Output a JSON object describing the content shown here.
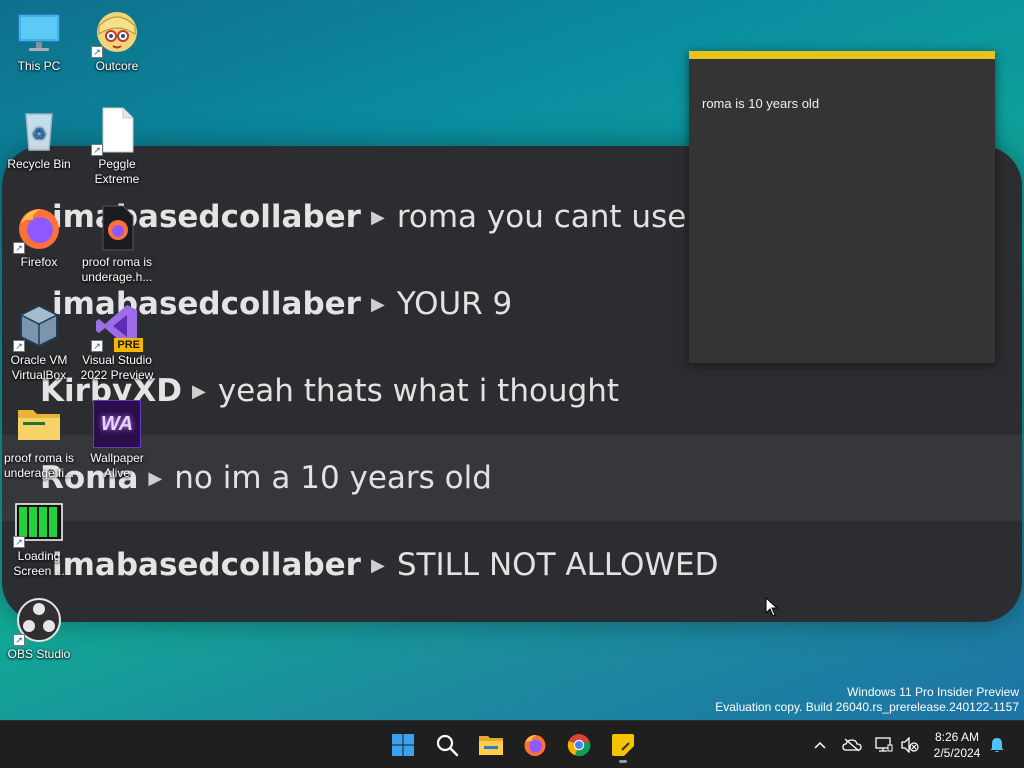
{
  "wallpaper": {
    "chat": [
      {
        "user": "imabasedcollaber",
        "message": "roma you cant use co"
      },
      {
        "user": "imabasedcollaber",
        "message": "YOUR 9"
      },
      {
        "user": "KirbyXD",
        "message": "yeah thats what i thought"
      },
      {
        "user": "Roma",
        "message": "no im a 10 years old"
      },
      {
        "user": "imabasedcollaber",
        "message": "STILL NOT ALLOWED"
      }
    ]
  },
  "desktop_icons": [
    {
      "label": "This PC",
      "icon": "monitor-icon"
    },
    {
      "label": "Outcore",
      "icon": "outcore-icon"
    },
    {
      "label": "Recycle Bin",
      "icon": "recycle-bin-icon"
    },
    {
      "label": "Peggle Extreme",
      "icon": "file-icon"
    },
    {
      "label": "Firefox",
      "icon": "firefox-icon"
    },
    {
      "label": "proof roma is underage.h...",
      "icon": "html-file-icon"
    },
    {
      "label": "Oracle VM VirtualBox",
      "icon": "virtualbox-icon"
    },
    {
      "label": "Visual Studio 2022 Preview",
      "icon": "visual-studio-icon"
    },
    {
      "label": "proof roma is underage.fi...",
      "icon": "folder-icon"
    },
    {
      "label": "Wallpaper Alive",
      "icon": "wallpaper-alive-icon"
    },
    {
      "label": "Loading Screen ...",
      "icon": "loading-screen-icon"
    },
    {
      "label": "OBS Studio",
      "icon": "obs-icon"
    }
  ],
  "visual_studio_badge": "PRE",
  "wallpaper_alive_badge": "WA",
  "sticky_note": {
    "text": "roma is 10 years old",
    "accent": "#e7c31a"
  },
  "watermark": {
    "line1": "Windows 11 Pro Insider Preview",
    "line2": "Evaluation copy. Build 26040.rs_prerelease.240122-1157"
  },
  "taskbar": {
    "apps": [
      "start-icon",
      "search-icon",
      "file-explorer-icon",
      "firefox-icon",
      "chrome-icon",
      "sticky-notes-icon"
    ],
    "time": "8:26 AM",
    "date": "2/5/2024"
  }
}
